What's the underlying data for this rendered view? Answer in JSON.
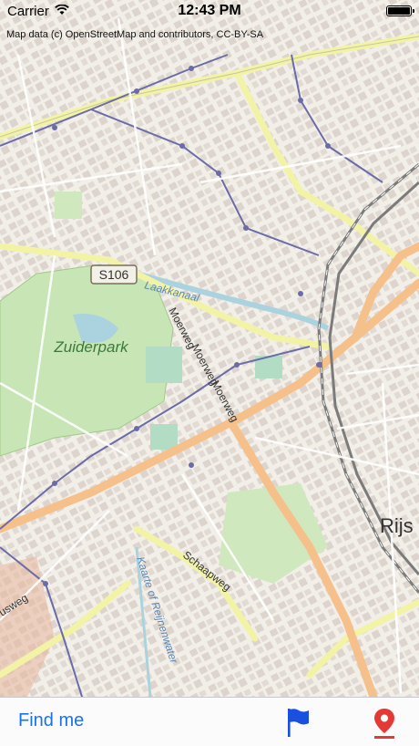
{
  "status_bar": {
    "carrier": "Carrier",
    "time": "12:43 PM",
    "battery_level": 1.0
  },
  "map": {
    "attribution": "Map data (c) OpenStreetMap and contributors, CC-BY-SA",
    "labels": {
      "road_shield": "S106",
      "park": "Zuiderpark",
      "canal": "Laakkanaal",
      "street_1": "Moerweg",
      "street_2": "Moerweg",
      "street_3": "Moerweg",
      "street_4": "Schaapweg",
      "street_5": "Kaarte of Reijnenwater",
      "street_6": "Rijs",
      "street_7": "usweg"
    },
    "colors": {
      "land": "#f2efe9",
      "park": "#c8e6b5",
      "primary_road": "#f5c089",
      "secondary_road": "#f3f3a6",
      "railway": "#7b7b7b",
      "water": "#aad3df",
      "building": "#d9d0c9"
    }
  },
  "toolbar": {
    "find_me": "Find me",
    "flag_icon": "flag-icon",
    "pin_icon": "map-pin-icon"
  }
}
